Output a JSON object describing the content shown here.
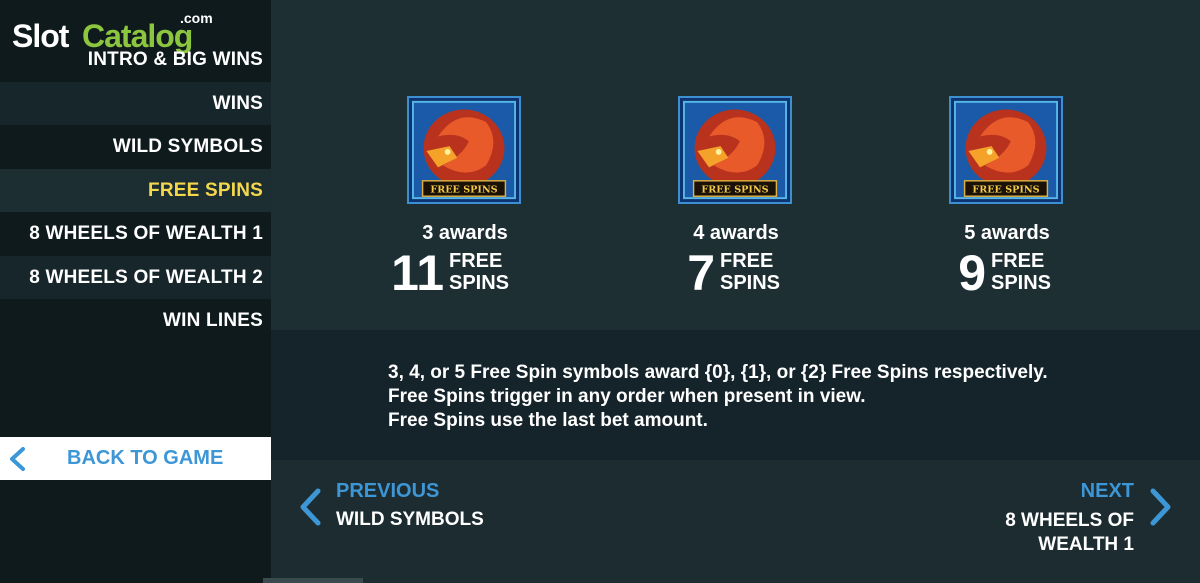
{
  "brand": {
    "slot": "Slot",
    "catalog": "Catalog",
    "com": ".com"
  },
  "sidebar": {
    "items": [
      {
        "label": "INTRO & BIG WINS"
      },
      {
        "label": "WINS"
      },
      {
        "label": "WILD SYMBOLS"
      },
      {
        "label": "FREE SPINS"
      },
      {
        "label": "8 WHEELS OF WEALTH 1"
      },
      {
        "label": "8 WHEELS OF WEALTH 2"
      },
      {
        "label": "WIN LINES"
      }
    ],
    "active": "FREE SPINS",
    "back_label": "BACK TO GAME"
  },
  "symbols": [
    {
      "banner": "FREE SPINS",
      "awards": "3 awards",
      "count": "11",
      "unit_line1": "FREE",
      "unit_line2": "SPINS"
    },
    {
      "banner": "FREE SPINS",
      "awards": "4 awards",
      "count": "7",
      "unit_line1": "FREE",
      "unit_line2": "SPINS"
    },
    {
      "banner": "FREE SPINS",
      "awards": "5 awards",
      "count": "9",
      "unit_line1": "FREE",
      "unit_line2": "SPINS"
    }
  ],
  "description": {
    "line1": "3, 4, or 5 Free Spin symbols award {0}, {1}, or {2} Free Spins respectively.",
    "line2": "Free Spins trigger in any order when present in view.",
    "line3": "Free Spins use the last bet amount."
  },
  "nav": {
    "previous_label": "PREVIOUS",
    "previous_target": "WILD SYMBOLS",
    "next_label": "NEXT",
    "next_target": "8 WHEELS OF WEALTH 1"
  },
  "colors": {
    "accent": "#3d96d6",
    "active": "#f4d74b",
    "logo_green": "#8cc63f"
  },
  "icons": [
    "chevron-left-icon",
    "dragon-symbol-icon",
    "chevron-right-icon"
  ]
}
